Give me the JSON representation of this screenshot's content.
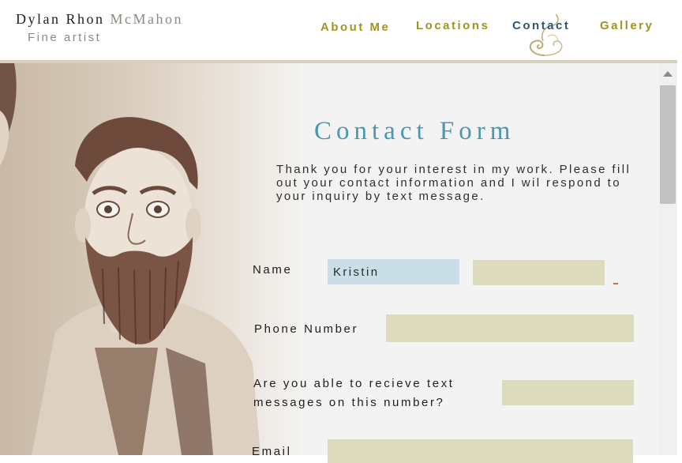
{
  "brand": {
    "first_name": "Dylan Rhon",
    "last_name": "McMahon",
    "subtitle": "Fine artist"
  },
  "nav": {
    "items": [
      {
        "label": "About Me"
      },
      {
        "label": "Locations"
      },
      {
        "label": "Contact",
        "active": true
      },
      {
        "label": "Gallery"
      }
    ]
  },
  "form": {
    "title": "Contact Form",
    "intro": "Thank you for your interest in my work. Please fill out your contact information and I wil respond to your inquiry by text message.",
    "name_label": "Name",
    "first_name_value": "Kristin",
    "last_name_value": "",
    "phone_label": "Phone Number",
    "phone_value": "",
    "text_question": "Are you able to recieve text messages on this number?",
    "text_value": "",
    "email_label": "Email",
    "email_value": ""
  },
  "colors": {
    "nav": "#9f9520",
    "nav_active": "#2f5670",
    "title": "#4a97b2",
    "field_bg": "#dcdcbd",
    "field_focus": "#c9dee6"
  },
  "icons": {
    "nav_ornament": "swirl-ornament-icon",
    "scroll_up": "chevron-up-icon"
  }
}
